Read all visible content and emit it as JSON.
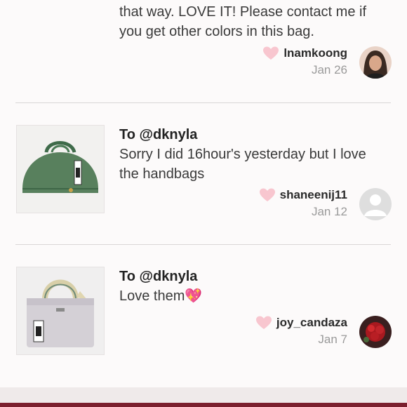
{
  "comments": [
    {
      "lines": [
        "that way. LOVE IT! Please contact me if",
        "you get other colors in this bag."
      ],
      "username": "lnamkoong",
      "date": "Jan 26"
    },
    {
      "to": "To @dknyla",
      "text": "Sorry I did 16hour's yesterday but I love the handbags",
      "username": "shaneenij11",
      "date": "Jan 12"
    },
    {
      "to": "To @dknyla",
      "text": "Love them💖",
      "username": "joy_candaza",
      "date": "Jan 7"
    }
  ],
  "colors": {
    "heart": "#f8c6cf",
    "footer": "#7b1f2e"
  }
}
